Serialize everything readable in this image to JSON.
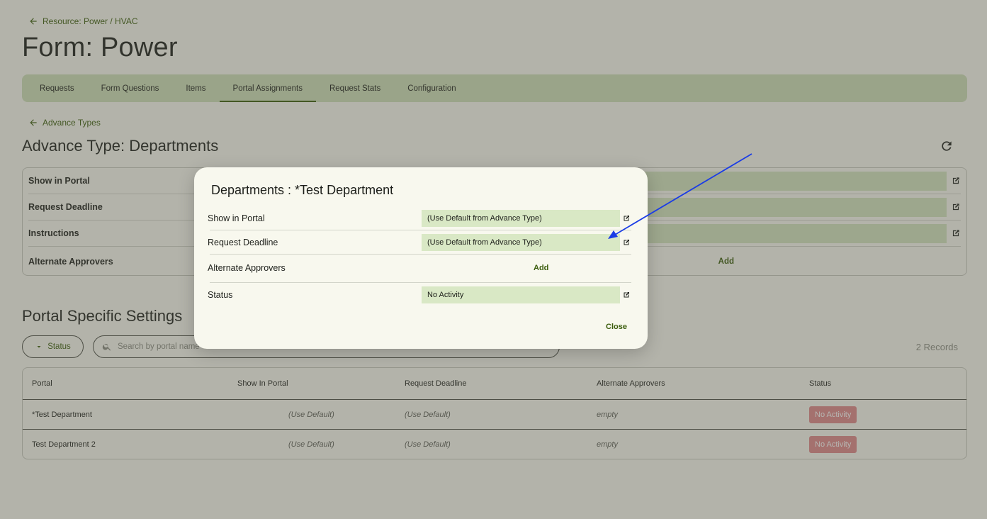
{
  "header": {
    "breadcrumb": "Resource: Power / HVAC",
    "title": "Form: Power"
  },
  "tabs": [
    {
      "label": "Requests"
    },
    {
      "label": "Form Questions"
    },
    {
      "label": "Items"
    },
    {
      "label": "Portal Assignments"
    },
    {
      "label": "Request Stats"
    },
    {
      "label": "Configuration"
    }
  ],
  "advance": {
    "breadcrumb": "Advance Types",
    "title": "Advance Type: Departments",
    "rows": [
      {
        "label": "Show in Portal"
      },
      {
        "label": "Request Deadline"
      },
      {
        "label": "Instructions"
      },
      {
        "label": "Alternate Approvers",
        "action": "Add"
      }
    ]
  },
  "portal_settings": {
    "title": "Portal Specific Settings",
    "filter_label": "Status",
    "search_placeholder": "Search by portal name",
    "records": "2 Records",
    "columns": [
      "Portal",
      "Show In Portal",
      "Request Deadline",
      "Alternate Approvers",
      "Status"
    ],
    "rows": [
      {
        "portal": "*Test Department",
        "show": "(Use Default)",
        "deadline": "(Use Default)",
        "approvers": "empty",
        "status": "No Activity"
      },
      {
        "portal": "Test Department 2",
        "show": "(Use Default)",
        "deadline": "(Use Default)",
        "approvers": "empty",
        "status": "No Activity"
      }
    ]
  },
  "modal": {
    "title": "Departments : *Test Department",
    "rows": [
      {
        "label": "Show in Portal",
        "value": "(Use Default from Advance Type)"
      },
      {
        "label": "Request Deadline",
        "value": "(Use Default from Advance Type)"
      },
      {
        "label": "Alternate Approvers",
        "action": "Add"
      },
      {
        "label": "Status",
        "value": "No Activity"
      }
    ],
    "close_label": "Close"
  },
  "colors": {
    "accent": "#3b5d0c",
    "tab_bg": "#cfe0b8",
    "field_bg": "#d9e8c5",
    "badge": "#e0888a",
    "annotation_arrow": "#1a3ce6"
  }
}
